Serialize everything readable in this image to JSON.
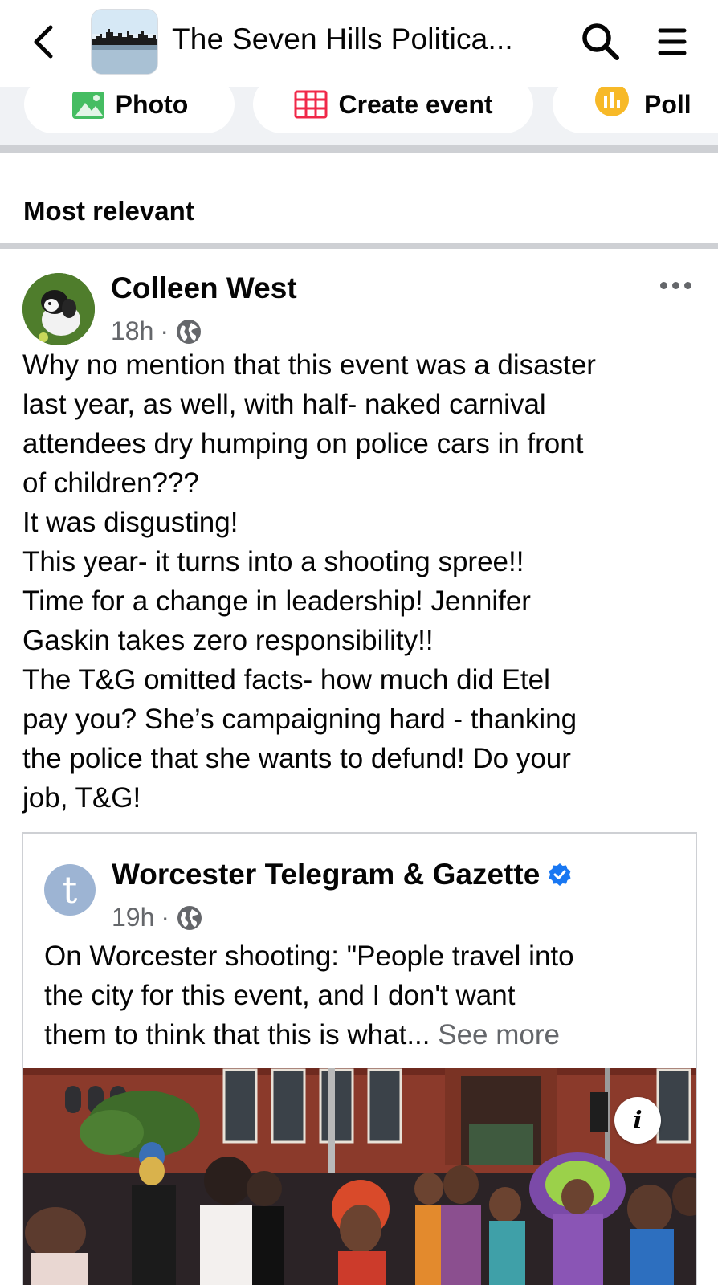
{
  "topbar": {
    "title": "The Seven Hills Politica...",
    "back_icon": "chevron-left-icon",
    "search_icon": "search-icon",
    "menu_icon": "hamburger-menu-icon"
  },
  "composer": {
    "photo_label": "Photo",
    "event_label": "Create event",
    "poll_label": "Poll"
  },
  "sort": {
    "label": "Most relevant"
  },
  "post": {
    "author": "Colleen West",
    "time": "18h",
    "separator": "·",
    "audience_icon": "globe-icon",
    "body_lines": [
      "Why no mention that this event was a disaster",
      "last year, as well, with half- naked carnival",
      "attendees dry humping on police cars in front",
      "of children???",
      "It was disgusting!",
      "This year- it turns into a shooting spree!!",
      "Time for a change in leadership! Jennifer",
      "Gaskin takes zero responsibility!!",
      "The T&G omitted facts- how much did Etel",
      "pay you? She’s campaigning hard - thanking",
      "the police that she wants to defund! Do your",
      "job, T&G!"
    ]
  },
  "shared": {
    "avatar_letter": "t",
    "page_name": "Worcester Telegram & Gazette",
    "verified_icon": "verified-badge-icon",
    "time": "19h",
    "separator": "·",
    "body_lines": [
      "On Worcester shooting: \"People travel into",
      "the city for this event, and I don't want"
    ],
    "last_line": "them to think that this is what...",
    "see_more": "See more",
    "info_label": "i"
  },
  "colors": {
    "text_primary": "#050505",
    "text_secondary": "#65676b",
    "separator": "#ced0d4",
    "verified_blue": "#1877f2",
    "photo_green": "#45bd62",
    "event_red": "#f02849",
    "poll_orange": "#f7b928"
  }
}
